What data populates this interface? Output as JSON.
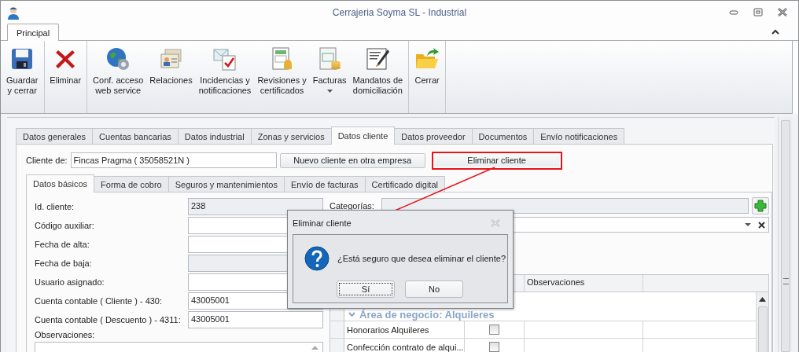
{
  "window": {
    "title": "Cerrajeria Soyma SL - Industrial"
  },
  "ribbon": {
    "tabs": [
      {
        "label": "Principal",
        "selected": true
      }
    ],
    "groups": [
      {
        "buttons": [
          {
            "label": "Guardar\ny cerrar",
            "kind": "save",
            "dropdown": false,
            "separator_after": true
          },
          {
            "label": "Eliminar",
            "kind": "delete",
            "dropdown": false,
            "separator_after": false
          }
        ]
      },
      {
        "buttons": [
          {
            "label": "Conf. acceso\nweb service",
            "kind": "globe",
            "dropdown": false,
            "separator_after": false
          },
          {
            "label": "Relaciones",
            "kind": "cards",
            "dropdown": false,
            "separator_after": false
          },
          {
            "label": "Incidencias y\nnotificaciones",
            "kind": "mail",
            "dropdown": false,
            "separator_after": false
          },
          {
            "label": "Revisiones y\ncertificados",
            "kind": "bell",
            "dropdown": false,
            "separator_after": false
          },
          {
            "label": "Facturas",
            "kind": "invoice",
            "dropdown": true,
            "separator_after": false
          },
          {
            "label": "Mandatos de\ndomiciliación",
            "kind": "pen",
            "dropdown": false,
            "separator_after": false
          }
        ]
      },
      {
        "buttons": [
          {
            "label": "Cerrar",
            "kind": "folder",
            "dropdown": false,
            "separator_after": false
          }
        ]
      }
    ]
  },
  "tabs": [
    {
      "label": "Datos generales",
      "selected": false
    },
    {
      "label": "Cuentas bancarias",
      "selected": false
    },
    {
      "label": "Datos industrial",
      "selected": false
    },
    {
      "label": "Zonas y servicios",
      "selected": false
    },
    {
      "label": "Datos cliente",
      "selected": true
    },
    {
      "label": "Datos proveedor",
      "selected": false
    },
    {
      "label": "Documentos",
      "selected": false
    },
    {
      "label": "Envío notificaciones",
      "selected": false
    }
  ],
  "client": {
    "label": "Cliente de:",
    "value": "Fincas Pragma ( 35058521N )",
    "buttons": [
      {
        "label": "Nuevo cliente en otra empresa",
        "highlighted": false
      },
      {
        "label": "Eliminar cliente",
        "highlighted": true
      }
    ]
  },
  "subtabs": [
    {
      "label": "Datos básicos",
      "selected": true
    },
    {
      "label": "Forma de cobro",
      "selected": false
    },
    {
      "label": "Seguros y mantenimientos",
      "selected": false
    },
    {
      "label": "Envío de facturas",
      "selected": false
    },
    {
      "label": "Certificado digital",
      "selected": false
    }
  ],
  "fields": [
    {
      "label": "Id. cliente:",
      "value": "238",
      "disabled": true
    },
    {
      "label": "Código auxiliar:",
      "disabled": false
    },
    {
      "label": "Fecha de alta:",
      "disabled": false
    },
    {
      "label": "Fecha de baja:",
      "disabled": true
    },
    {
      "label": "Usuario asignado:",
      "disabled": false
    },
    {
      "label": "Cuenta contable ( Cliente ) - 430:",
      "value": "43005001",
      "disabled": false
    },
    {
      "label": "Cuenta contable ( Descuento ) - 4311:",
      "value": "43005001",
      "disabled": false
    }
  ],
  "notes": {
    "label": "Observaciones:"
  },
  "categories": {
    "label": "Categorías:"
  },
  "grid": {
    "columns": [
      "Observaciones"
    ],
    "group": "Área de negocio: Alquileres",
    "rows": [
      {
        "name": "Honorarios Alquileres",
        "checked": false
      },
      {
        "name": "Confección contrato de alqui...",
        "checked": false
      }
    ]
  },
  "dialog": {
    "title": "Eliminar cliente",
    "message": "¿Está seguro que desea eliminar el cliente?",
    "buttons": [
      {
        "label": "Sí",
        "focused": true
      },
      {
        "label": "No",
        "focused": false
      }
    ]
  }
}
